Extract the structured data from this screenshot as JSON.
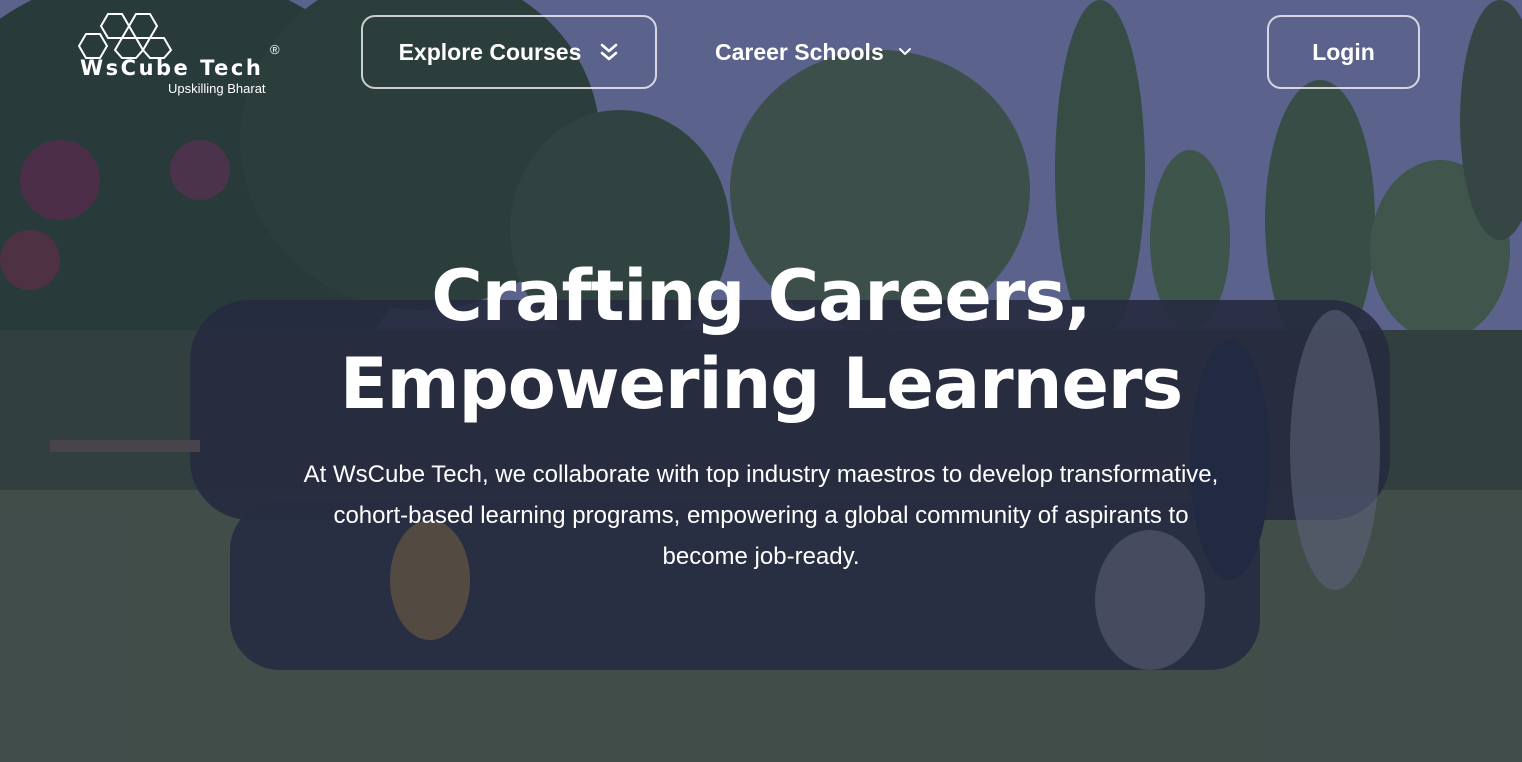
{
  "brand": {
    "name": "WsCube Tech",
    "registered": "®",
    "tagline": "Upskilling Bharat"
  },
  "nav": {
    "explore_label": "Explore Courses",
    "career_label": "Career Schools",
    "login_label": "Login"
  },
  "hero": {
    "headline_line1": "Crafting Careers,",
    "headline_line2": "Empowering Learners",
    "description": "At WsCube Tech, we collaborate with top industry maestros to develop transformative, cohort-based learning programs, empowering a global community of aspirants to become job-ready.",
    "background": "group-photo"
  },
  "icons": {
    "explore": "double-chevron-down-icon",
    "career": "chevron-down-icon"
  },
  "colors": {
    "overlay": "#22284e",
    "text": "#ffffff"
  }
}
